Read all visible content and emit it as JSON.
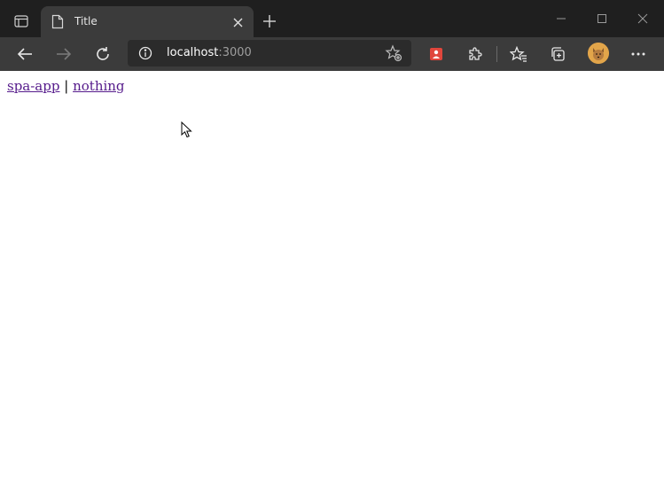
{
  "tab": {
    "title": "Title"
  },
  "address_bar": {
    "host": "localhost",
    "port": ":3000"
  },
  "page": {
    "links": [
      {
        "label": "spa-app"
      },
      {
        "label": "nothing"
      }
    ],
    "separator": "|"
  },
  "icons": {
    "tab_actions": "tab-actions-icon",
    "favicon": "page-icon",
    "tab_close": "close-icon",
    "new_tab": "plus-icon",
    "minimize": "minimize-icon",
    "maximize": "maximize-icon",
    "window_close": "close-icon",
    "back": "arrow-left-icon",
    "forward": "arrow-right-icon",
    "refresh": "refresh-icon",
    "site_info": "info-icon",
    "add_favorite": "star-add-icon",
    "extension_red": "extension-icon",
    "extensions": "puzzle-icon",
    "favorites": "favorites-icon",
    "collections": "collections-icon",
    "profile": "avatar",
    "menu": "more-icon"
  },
  "colors": {
    "tabstrip": "#1f1f1f",
    "toolbar": "#3b3b3b",
    "address_bg": "#2b2b2b",
    "link": "#551a8b",
    "extension_red": "#e0463c",
    "avatar": "#e2a54a"
  }
}
